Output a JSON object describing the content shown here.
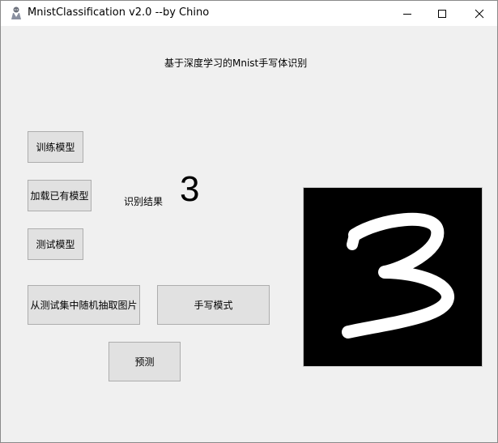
{
  "window": {
    "title": "MnistClassification v2.0 --by Chino",
    "icon": "app-icon"
  },
  "controls": {
    "minimize_icon": "minimize-icon",
    "maximize_icon": "maximize-icon",
    "close_icon": "close-icon"
  },
  "main": {
    "heading": "基于深度学习的Mnist手写体识别",
    "buttons": {
      "train": "训练模型",
      "load": "加载已有模型",
      "test": "测试模型",
      "random": "从测试集中随机抽取图片",
      "handwrite": "手写模式",
      "predict": "预测"
    },
    "result_label": "识别结果",
    "result_value": "3",
    "image": {
      "background": "#000000",
      "stroke": "#ffffff",
      "content": "handwritten digit"
    }
  }
}
